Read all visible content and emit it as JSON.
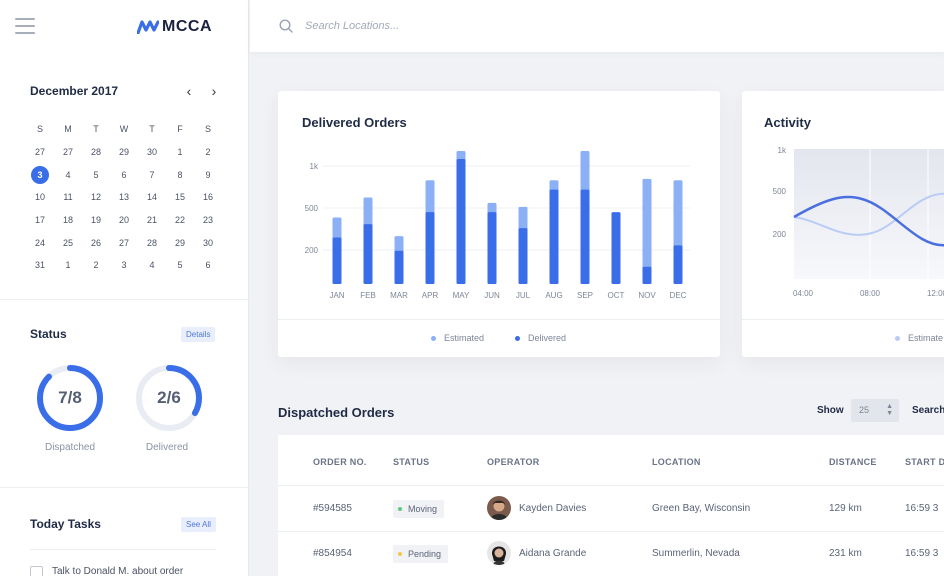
{
  "brand": {
    "name": "MCCA"
  },
  "search": {
    "placeholder": "Search Locations..."
  },
  "calendar": {
    "month_label": "December 2017",
    "weekdays": [
      "S",
      "M",
      "T",
      "W",
      "T",
      "F",
      "S"
    ],
    "weeks": [
      [
        "27",
        "27",
        "28",
        "29",
        "30",
        "1",
        "2"
      ],
      [
        "3",
        "4",
        "5",
        "6",
        "7",
        "8",
        "9"
      ],
      [
        "10",
        "11",
        "12",
        "13",
        "14",
        "15",
        "16"
      ],
      [
        "17",
        "18",
        "19",
        "20",
        "21",
        "22",
        "23"
      ],
      [
        "24",
        "25",
        "26",
        "27",
        "28",
        "29",
        "30"
      ],
      [
        "31",
        "1",
        "2",
        "3",
        "4",
        "5",
        "6"
      ]
    ],
    "selected": "3"
  },
  "status": {
    "title": "Status",
    "details_label": "Details",
    "dispatched": {
      "value": "7/8",
      "label": "Dispatched",
      "fraction": 0.875
    },
    "delivered": {
      "value": "2/6",
      "label": "Delivered",
      "fraction": 0.333
    }
  },
  "tasks": {
    "title": "Today Tasks",
    "see_all_label": "See All",
    "items": [
      {
        "text": "Talk to Donald M. about order"
      }
    ]
  },
  "delivered_orders": {
    "title": "Delivered Orders",
    "legend_estimated": "Estimated",
    "legend_delivered": "Delivered"
  },
  "activity": {
    "title": "Activity",
    "legend_estimated": "Estimate"
  },
  "chart_data": [
    {
      "type": "bar",
      "title": "Delivered Orders",
      "categories": [
        "JAN",
        "FEB",
        "MAR",
        "APR",
        "MAY",
        "JUN",
        "JUL",
        "AUG",
        "SEP",
        "OCT",
        "NOV",
        "DEC"
      ],
      "y_ticks": [
        "1k",
        "500",
        "200"
      ],
      "series": [
        {
          "name": "Estimated",
          "color": "#8bb0f6",
          "values": [
            0.5,
            0.65,
            0.36,
            0.78,
            1.0,
            0.61,
            0.58,
            0.78,
            1.0,
            0.53,
            0.79,
            0.78
          ]
        },
        {
          "name": "Delivered",
          "color": "#3a6ee8",
          "values": [
            0.35,
            0.45,
            0.25,
            0.54,
            0.94,
            0.54,
            0.42,
            0.71,
            0.71,
            0.54,
            0.13,
            0.29
          ]
        }
      ]
    },
    {
      "type": "line",
      "title": "Activity",
      "x": [
        "04:00",
        "08:00",
        "12:00"
      ],
      "y_ticks": [
        "1k",
        "500",
        "200"
      ],
      "series": [
        {
          "name": "Estimate",
          "color": "#b9ccf6"
        },
        {
          "color": "#4c6fe0"
        }
      ]
    }
  ],
  "dispatched": {
    "title": "Dispatched Orders",
    "show_label": "Show",
    "show_value": "25",
    "search_label": "Search",
    "columns": [
      "ORDER NO.",
      "STATUS",
      "OPERATOR",
      "LOCATION",
      "DISTANCE",
      "START D"
    ],
    "rows": [
      {
        "order": "#594585",
        "status": "Moving",
        "status_color": "#5ecb7a",
        "operator": "Kayden Davies",
        "location": "Green Bay, Wisconsin",
        "distance": "129 km",
        "start": "16:59 3"
      },
      {
        "order": "#854954",
        "status": "Pending",
        "status_color": "#f3c74e",
        "operator": "Aidana Grande",
        "location": "Summerlin, Nevada",
        "distance": "231 km",
        "start": "16:59 3"
      }
    ]
  }
}
